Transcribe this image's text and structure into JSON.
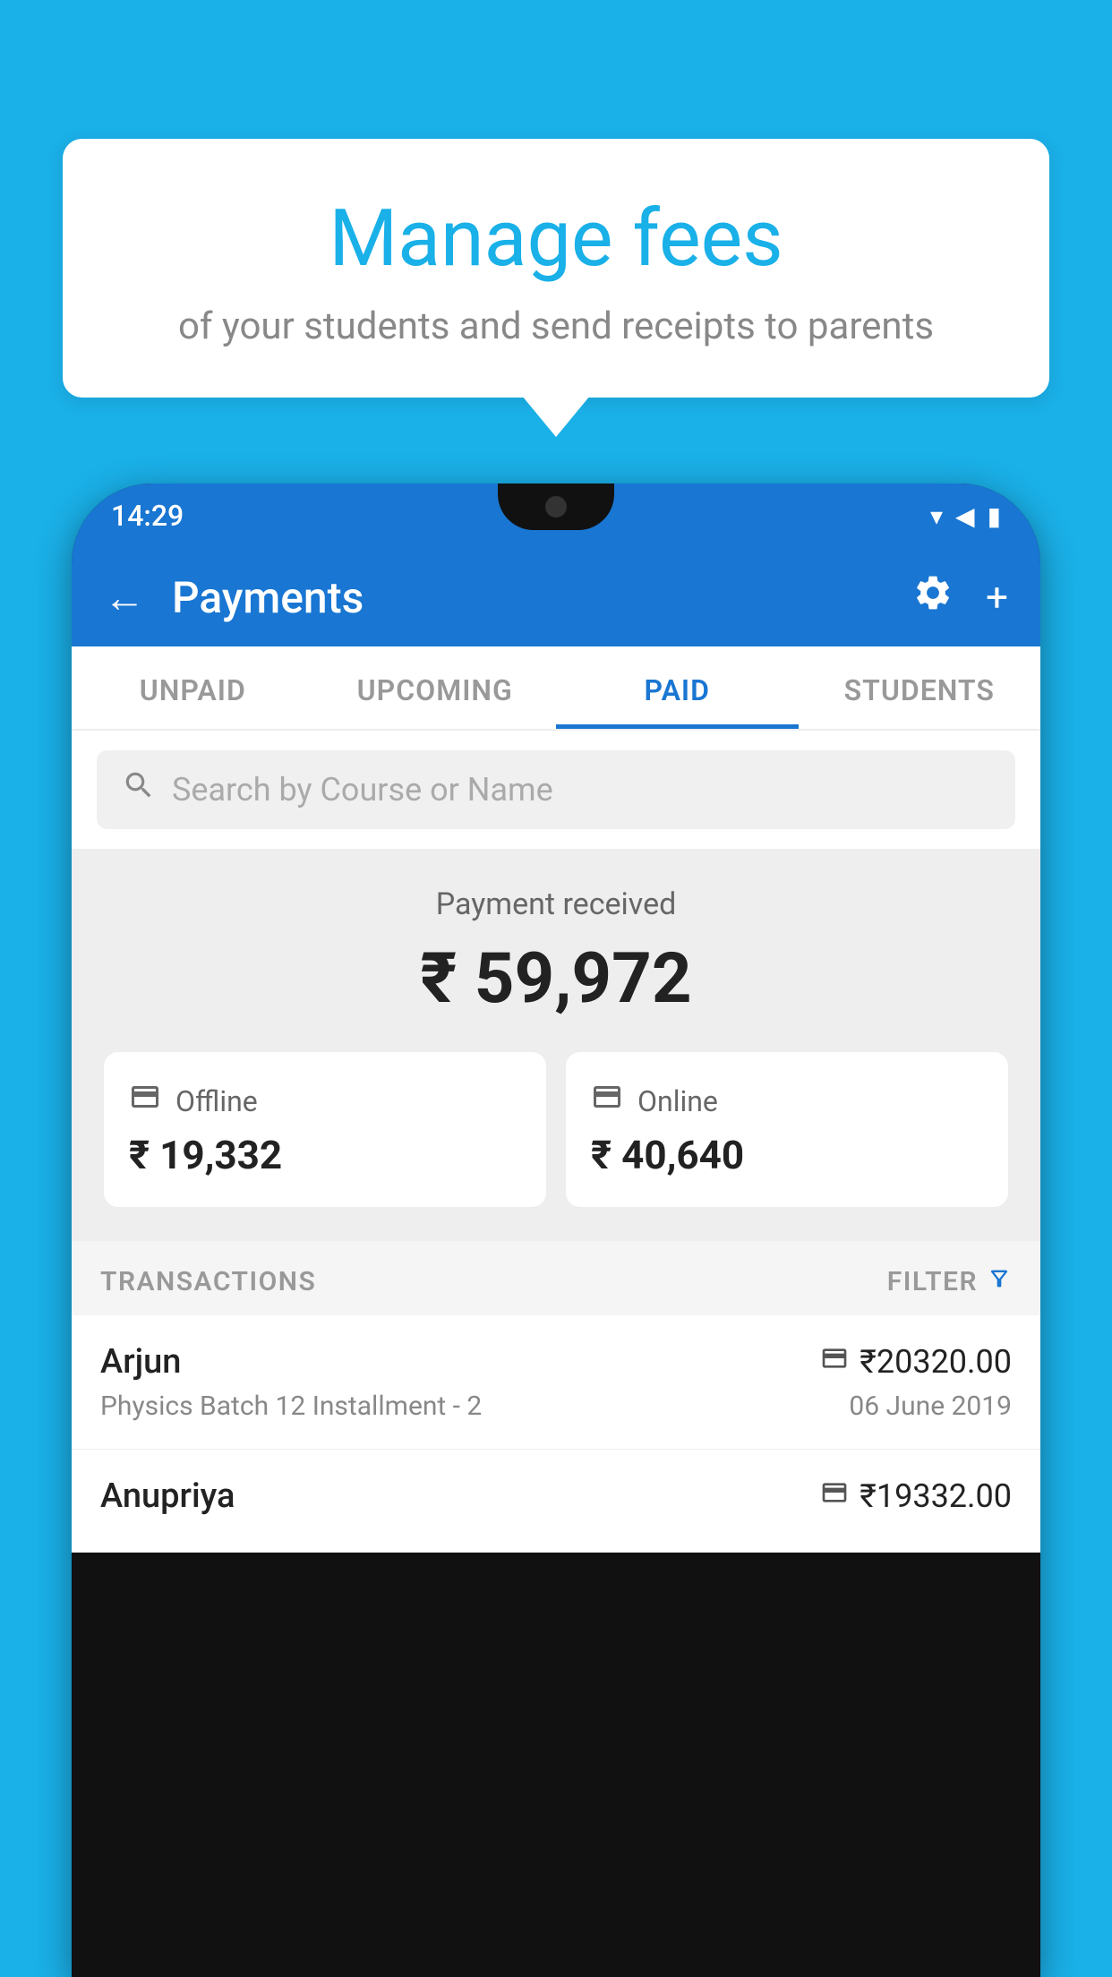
{
  "page": {
    "background_color": "#1ab0e8"
  },
  "bubble": {
    "title": "Manage fees",
    "subtitle": "of your students and send receipts to parents"
  },
  "status_bar": {
    "time": "14:29",
    "wifi_icon": "▾",
    "signal_icon": "◀",
    "battery_icon": "▮"
  },
  "app_bar": {
    "title": "Payments",
    "back_label": "←",
    "settings_label": "⚙",
    "add_label": "+"
  },
  "tabs": [
    {
      "id": "unpaid",
      "label": "UNPAID",
      "active": false
    },
    {
      "id": "upcoming",
      "label": "UPCOMING",
      "active": false
    },
    {
      "id": "paid",
      "label": "PAID",
      "active": true
    },
    {
      "id": "students",
      "label": "STUDENTS",
      "active": false
    }
  ],
  "search": {
    "placeholder": "Search by Course or Name"
  },
  "payment_summary": {
    "label": "Payment received",
    "amount": "₹ 59,972",
    "offline": {
      "icon": "💳",
      "label": "Offline",
      "amount": "₹ 19,332"
    },
    "online": {
      "icon": "💳",
      "label": "Online",
      "amount": "₹ 40,640"
    }
  },
  "transactions": {
    "header_label": "TRANSACTIONS",
    "filter_label": "FILTER",
    "rows": [
      {
        "name": "Arjun",
        "amount": "₹20320.00",
        "course": "Physics Batch 12 Installment - 2",
        "date": "06 June 2019",
        "payment_type": "online"
      },
      {
        "name": "Anupriya",
        "amount": "₹19332.00",
        "course": "",
        "date": "",
        "payment_type": "offline"
      }
    ]
  }
}
